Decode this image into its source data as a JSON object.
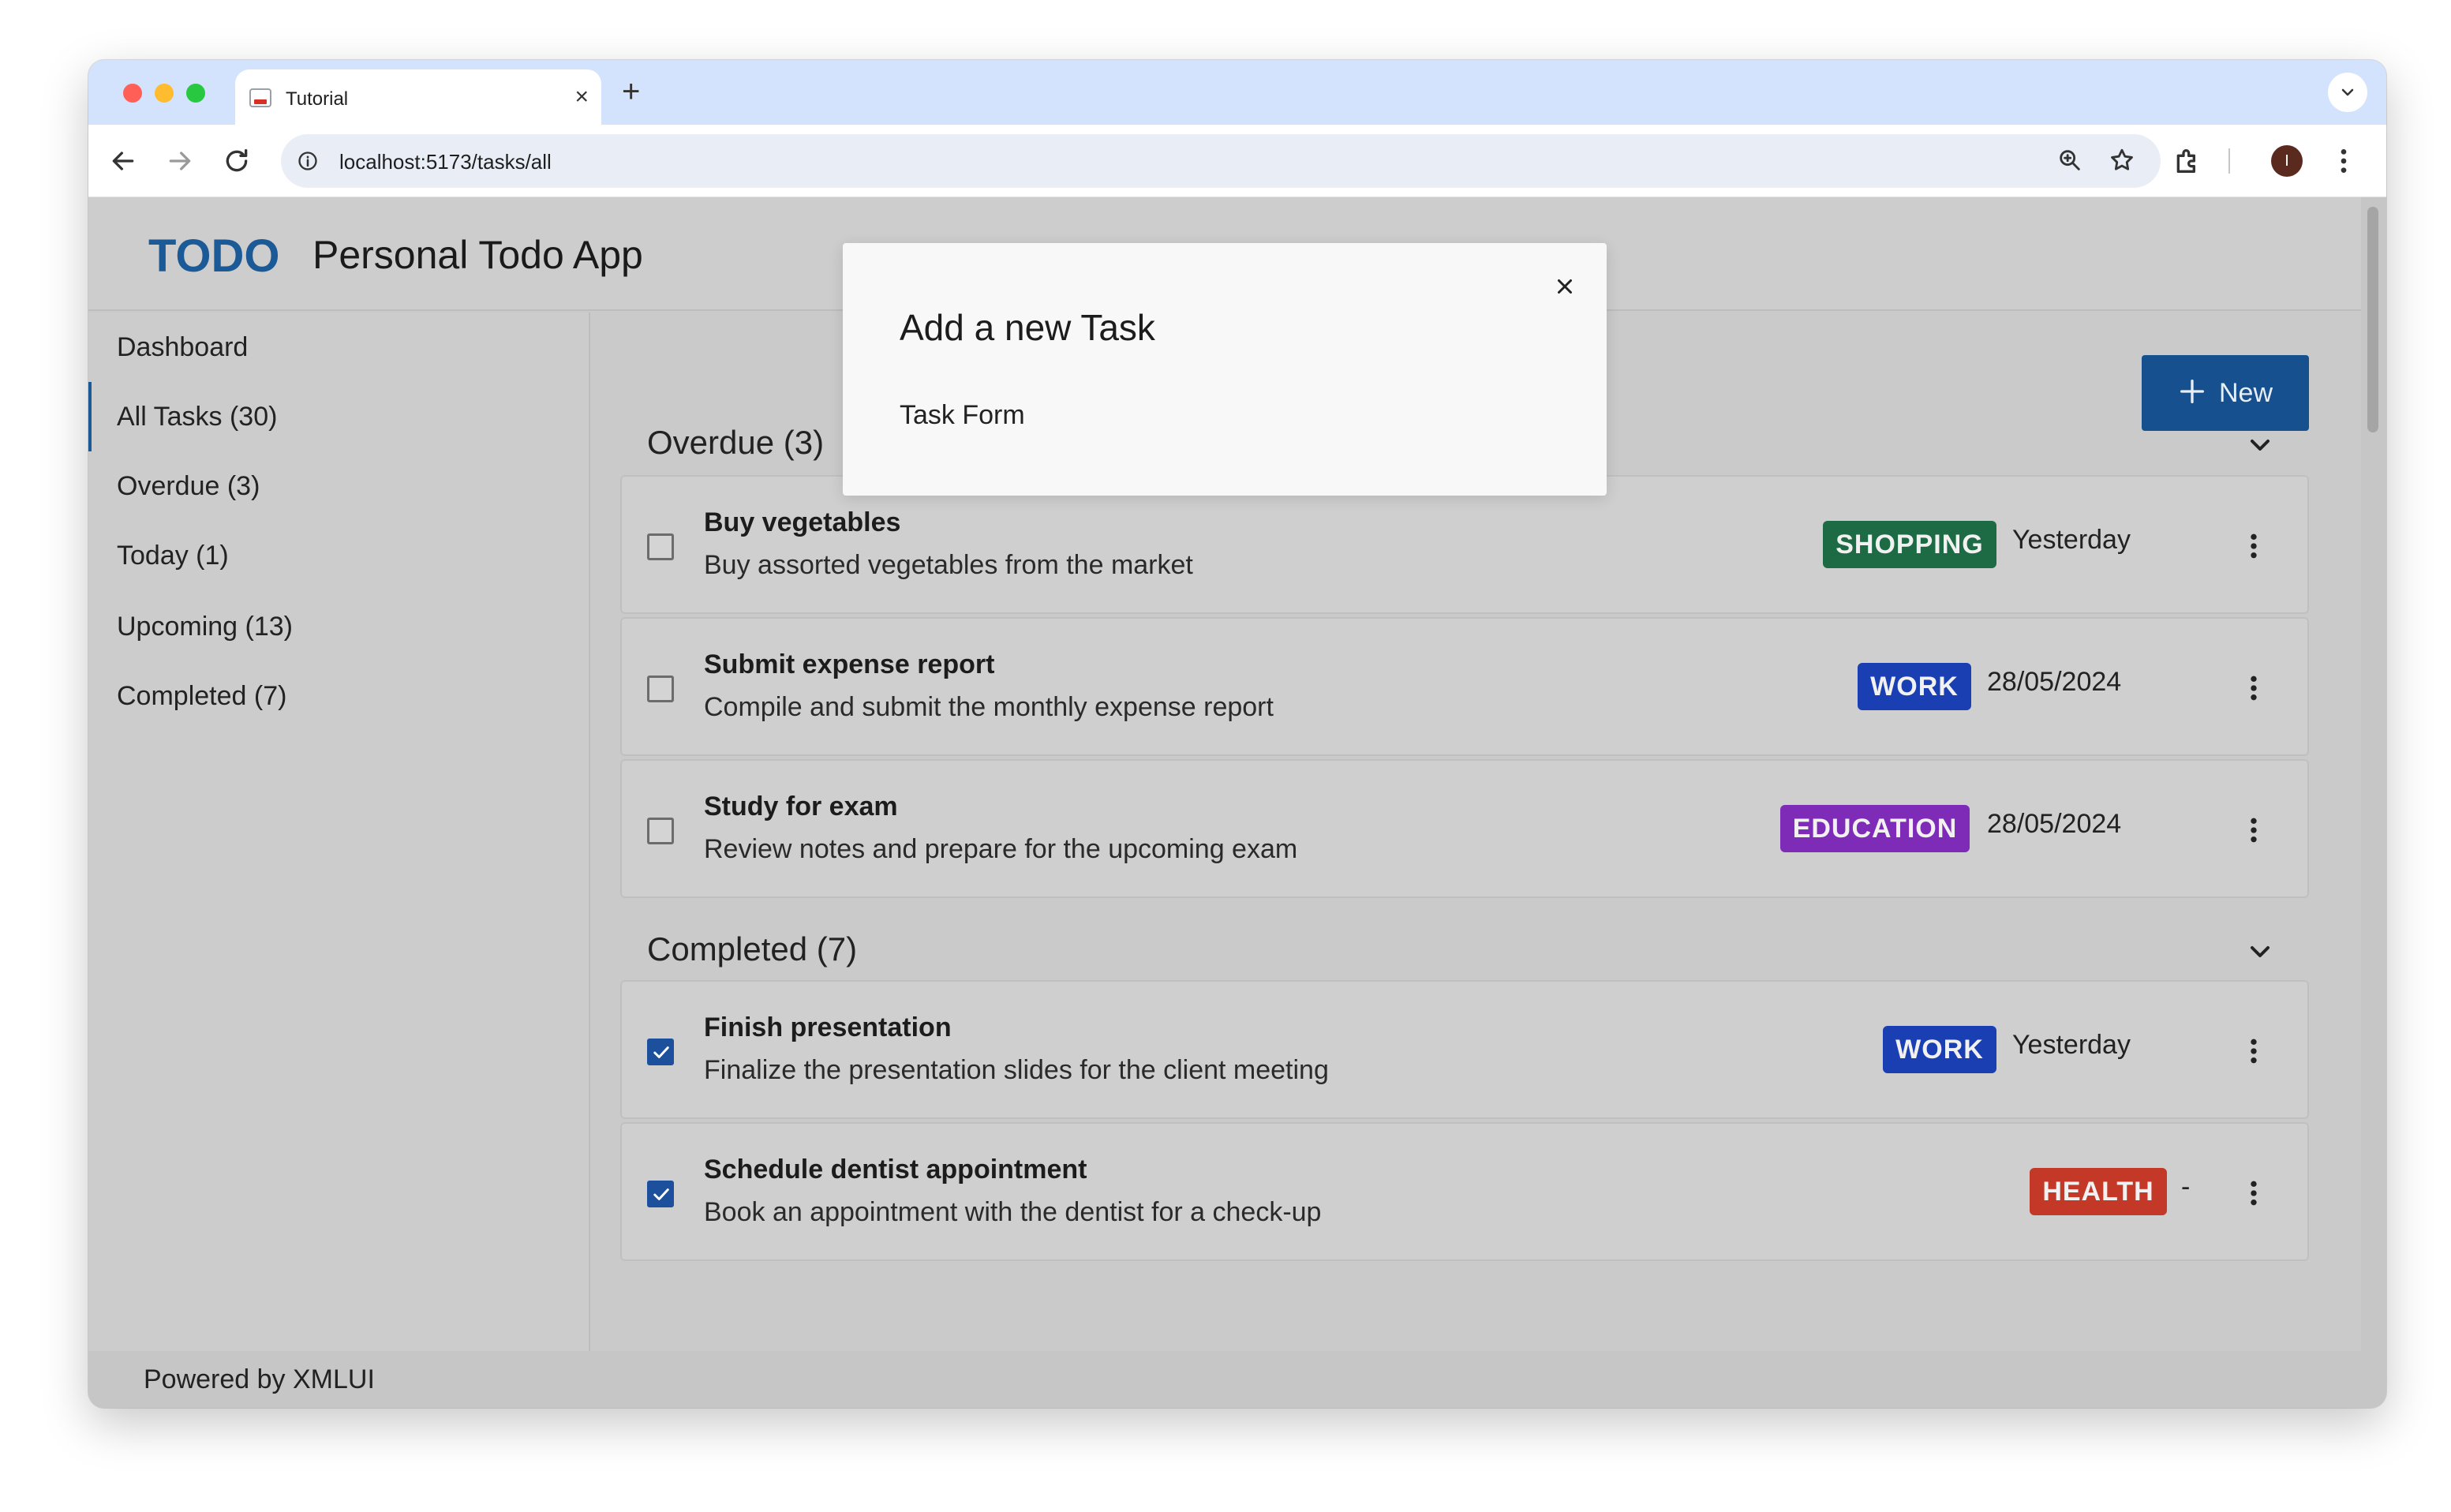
{
  "browser": {
    "tab_title": "Tutorial",
    "tab_close": "×",
    "new_tab": "+",
    "url": "localhost:5173/tasks/all",
    "profile_initial": "I"
  },
  "app": {
    "logo_text": "TODO",
    "title": "Personal Todo App",
    "footer": "Powered by XMLUI",
    "new_button_label": "New",
    "accent_color": "#1c5a97"
  },
  "sidebar": {
    "items": [
      {
        "label": "Dashboard",
        "active": false
      },
      {
        "label": "All Tasks (30)",
        "active": true
      },
      {
        "label": "Overdue (3)",
        "active": false
      },
      {
        "label": "Today (1)",
        "active": false
      },
      {
        "label": "Upcoming (13)",
        "active": false
      },
      {
        "label": "Completed (7)",
        "active": false
      }
    ]
  },
  "sections": {
    "overdue": {
      "title": "Overdue (3)",
      "tasks": [
        {
          "title": "Buy vegetables",
          "description": "Buy assorted vegetables from the market",
          "category": "SHOPPING",
          "category_color": "#1d6b45",
          "due": "Yesterday",
          "done": false
        },
        {
          "title": "Submit expense report",
          "description": "Compile and submit the monthly expense report",
          "category": "WORK",
          "category_color": "#1a3fb3",
          "due": "28/05/2024",
          "done": false
        },
        {
          "title": "Study for exam",
          "description": "Review notes and prepare for the upcoming exam",
          "category": "EDUCATION",
          "category_color": "#7e2bb8",
          "due": "28/05/2024",
          "done": false
        }
      ]
    },
    "completed": {
      "title": "Completed (7)",
      "tasks": [
        {
          "title": "Finish presentation",
          "description": "Finalize the presentation slides for the client meeting",
          "category": "WORK",
          "category_color": "#1a3fb3",
          "due": "Yesterday",
          "done": true
        },
        {
          "title": "Schedule dentist appointment",
          "description": "Book an appointment with the dentist for a check-up",
          "category": "HEALTH",
          "category_color": "#c43828",
          "due": "-",
          "done": true
        }
      ]
    }
  },
  "modal": {
    "title": "Add a new Task",
    "body": "Task Form"
  }
}
